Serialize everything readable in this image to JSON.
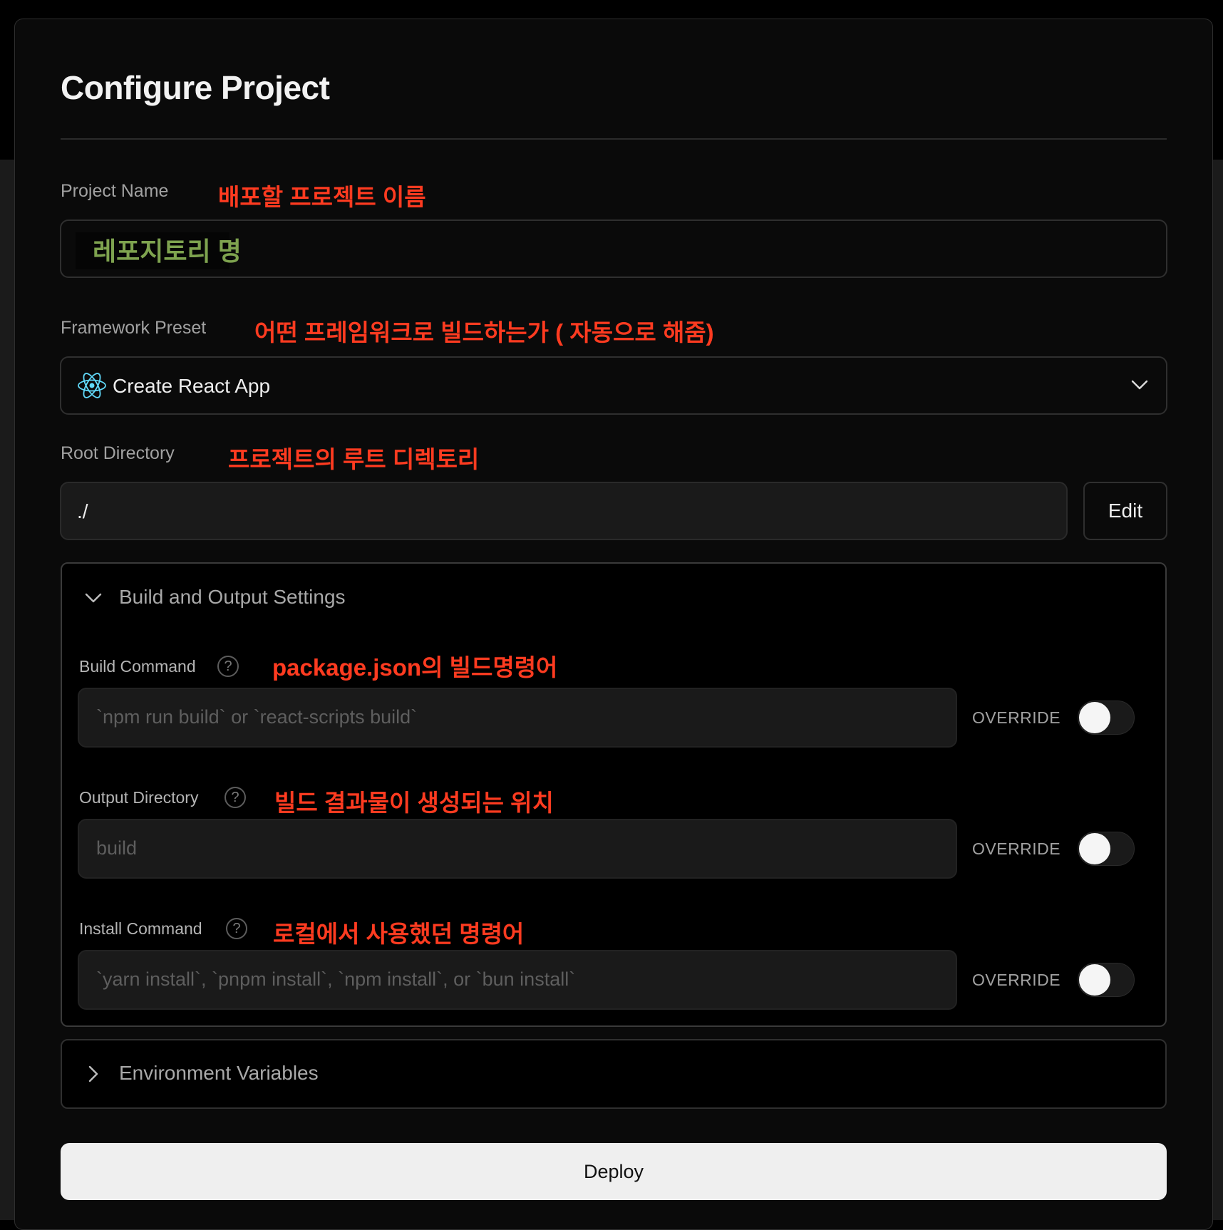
{
  "page": {
    "title": "Configure Project"
  },
  "project_name": {
    "label": "Project Name",
    "annotation": "배포할 프로젝트 이름",
    "value": "레포지토리 명"
  },
  "framework": {
    "label": "Framework Preset",
    "annotation": "어떤 프레임워크로 빌드하는가 ( 자동으로 해줌)",
    "value": "Create React App",
    "icon": "react-icon"
  },
  "root_directory": {
    "label": "Root Directory",
    "annotation": "프로젝트의 루트 디렉토리",
    "value": "./",
    "edit_label": "Edit"
  },
  "build_settings": {
    "title": "Build and Output Settings",
    "expanded": true,
    "build_command": {
      "label": "Build Command",
      "annotation": "package.json의 빌드명령어",
      "placeholder": "`npm run build` or `react-scripts build`",
      "override_label": "OVERRIDE",
      "override": false
    },
    "output_directory": {
      "label": "Output Directory",
      "annotation": "빌드 결과물이 생성되는 위치",
      "placeholder": "build",
      "override_label": "OVERRIDE",
      "override": false
    },
    "install_command": {
      "label": "Install Command",
      "annotation": "로컬에서 사용했던 명령어",
      "placeholder": "`yarn install`, `pnpm install`, `npm install`, or `bun install`",
      "override_label": "OVERRIDE",
      "override": false
    }
  },
  "env_vars": {
    "title": "Environment Variables",
    "expanded": false
  },
  "deploy": {
    "label": "Deploy"
  },
  "colors": {
    "annotation": "#ff3b20",
    "value_highlight": "#7ea34f",
    "background": "#0a0a0a"
  }
}
